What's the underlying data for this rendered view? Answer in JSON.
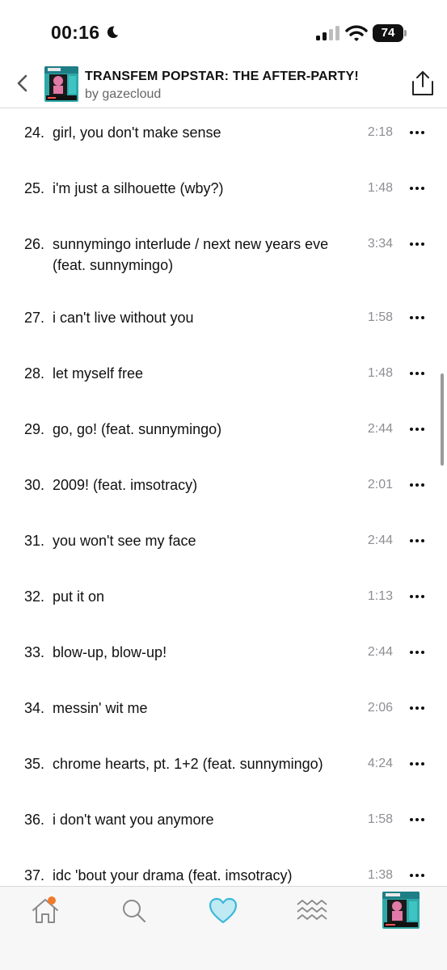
{
  "status_bar": {
    "time": "00:16",
    "battery": "74"
  },
  "header": {
    "album_title": "TRANSFEM POPSTAR: THE AFTER-PARTY!",
    "artist": "by gazecloud"
  },
  "tracks": [
    {
      "num": "24.",
      "title": "girl, you don't make sense",
      "duration": "2:18"
    },
    {
      "num": "25.",
      "title": "i'm just a silhouette (wby?)",
      "duration": "1:48"
    },
    {
      "num": "26.",
      "title": "sunnymingo interlude / next new years eve (feat. sunnymingo)",
      "duration": "3:34"
    },
    {
      "num": "27.",
      "title": "i can't live without you",
      "duration": "1:58"
    },
    {
      "num": "28.",
      "title": "let myself free",
      "duration": "1:48"
    },
    {
      "num": "29.",
      "title": "go, go! (feat. sunnymingo)",
      "duration": "2:44"
    },
    {
      "num": "30.",
      "title": "2009! (feat. imsotracy)",
      "duration": "2:01"
    },
    {
      "num": "31.",
      "title": "you won't see my face",
      "duration": "2:44"
    },
    {
      "num": "32.",
      "title": "put it on",
      "duration": "1:13"
    },
    {
      "num": "33.",
      "title": "blow-up, blow-up!",
      "duration": "2:44"
    },
    {
      "num": "34.",
      "title": "messin' wit me",
      "duration": "2:06"
    },
    {
      "num": "35.",
      "title": "chrome hearts, pt. 1+2 (feat. sunnymingo)",
      "duration": "4:24"
    },
    {
      "num": "36.",
      "title": "i don't want you anymore",
      "duration": "1:58"
    },
    {
      "num": "37.",
      "title": "idc 'bout your drama (feat. imsotracy)",
      "duration": "1:38"
    }
  ],
  "tab_bar": {
    "items": [
      {
        "icon": "home-icon",
        "badge_color": "#f07a2a"
      },
      {
        "icon": "search-icon"
      },
      {
        "icon": "heart-icon",
        "color": "#3bb8d8"
      },
      {
        "icon": "waves-icon"
      },
      {
        "icon": "now-playing-cover"
      }
    ]
  },
  "colors": {
    "accent": "#3bb8d8",
    "secondary_text": "#8e8e93",
    "cover_teal": "#2fa8a8",
    "cover_pink": "#e27aa8"
  }
}
